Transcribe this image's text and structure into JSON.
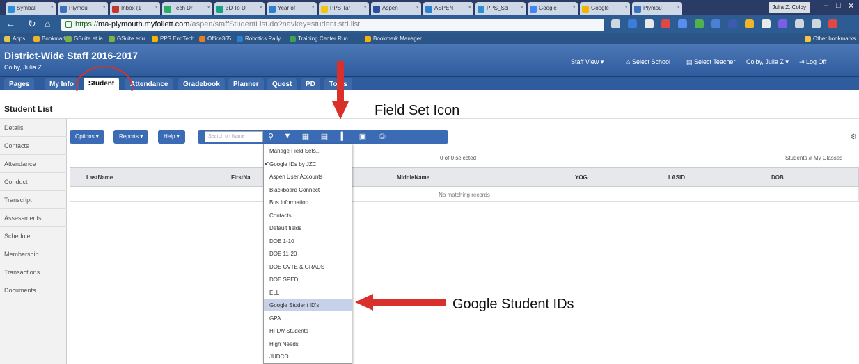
{
  "browser": {
    "tabs": [
      {
        "label": "Symbali"
      },
      {
        "label": "Plymou"
      },
      {
        "label": "Inbox (1"
      },
      {
        "label": "Tech Dr"
      },
      {
        "label": "3D To D"
      },
      {
        "label": "Year of"
      },
      {
        "label": "PPS Tar"
      },
      {
        "label": "Aspen"
      },
      {
        "label": "ASPEN"
      },
      {
        "label": "PPS_Sci"
      },
      {
        "label": "Google"
      },
      {
        "label": "Google"
      },
      {
        "label": "Plymou"
      }
    ],
    "window_user": "Julia Z. Colby",
    "url_prefix": "https://",
    "url_host": "ma-plymouth.myfollett.com",
    "url_path": "/aspen/staffStudentList.do?navkey=student.std.list",
    "bookmarks": [
      "Apps",
      "Bookmarks",
      "GSuite et ia",
      "GSuite edu",
      "PPS EndTech",
      "Office365",
      "Robotics Rally",
      "Training Center Run",
      "Bookmark Manager"
    ],
    "other_bookmarks": "Other bookmarks"
  },
  "aspen": {
    "district_title": "District-Wide Staff 2016-2017",
    "user_name": "Colby, Julia Z",
    "header_links": [
      "Staff View ▾",
      "⌂ Select School",
      "▤ Select Teacher",
      "Colby, Julia Z ▾",
      "⇥ Log Off"
    ],
    "main_tabs": [
      "Pages",
      "My Info",
      "Student",
      "Attendance",
      "Gradebook",
      "Planner",
      "Quest",
      "PD",
      "Tools"
    ],
    "active_tab": "Student",
    "page_title": "Student List",
    "side_nav": [
      "Details",
      "Contacts",
      "Attendance",
      "Conduct",
      "Transcript",
      "Assessments",
      "Schedule",
      "Membership",
      "Transactions",
      "Documents"
    ],
    "toolbar": {
      "options": "Options ▾",
      "reports": "Reports ▾",
      "help": "Help ▾",
      "search_placeholder": "Search on Name"
    },
    "selected_text": "0 of 0 selected",
    "students_in": "Students /r My Classes",
    "columns": [
      "LastName",
      "FirstNa",
      "MiddleName",
      "YOG",
      "LASID",
      "DOB"
    ],
    "empty_message": "No matching records",
    "field_sets": [
      {
        "label": "Manage Field Sets...",
        "checked": false
      },
      {
        "label": "Google IDs by JZC",
        "checked": true
      },
      {
        "label": "Aspen User Accounts",
        "checked": false
      },
      {
        "label": "Blackboard Connect",
        "checked": false
      },
      {
        "label": "Bus Information",
        "checked": false
      },
      {
        "label": "Contacts",
        "checked": false
      },
      {
        "label": "Default fields",
        "checked": false
      },
      {
        "label": "DOE 1-10",
        "checked": false
      },
      {
        "label": "DOE 11-20",
        "checked": false
      },
      {
        "label": "DOE CVTE & GRADS",
        "checked": false
      },
      {
        "label": "DOE SPED",
        "checked": false
      },
      {
        "label": "ELL",
        "checked": false
      },
      {
        "label": "Google Student ID's",
        "checked": false
      },
      {
        "label": "GPA",
        "checked": false
      },
      {
        "label": "HFLW Students",
        "checked": false
      },
      {
        "label": "High Needs",
        "checked": false
      },
      {
        "label": "JUDCO",
        "checked": false
      }
    ],
    "highlighted_field_set": "Google Student ID's"
  },
  "annotations": {
    "field_set_icon": "Field Set Icon",
    "google_student_ids": "Google Student IDs",
    "arrow_color": "#d9302b"
  }
}
